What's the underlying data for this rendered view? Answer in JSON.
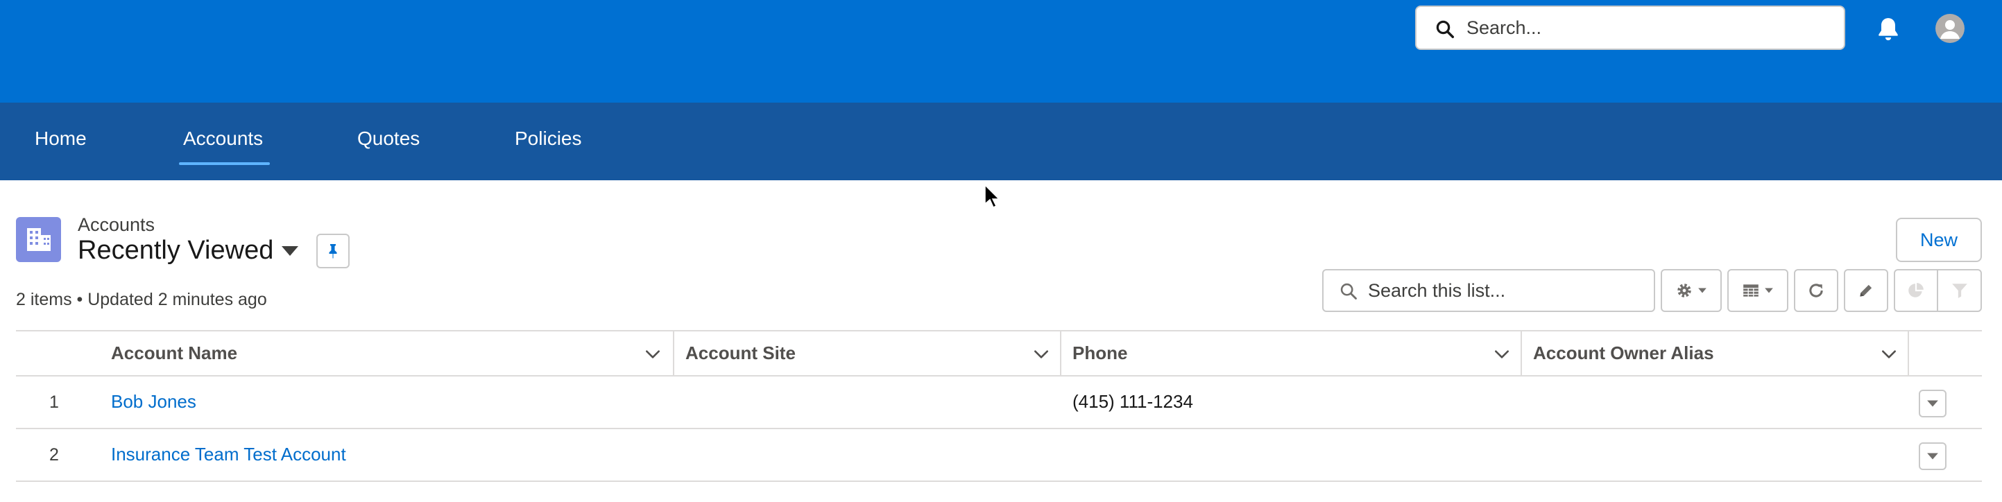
{
  "header": {
    "search_placeholder": "Search...",
    "search_icon": "search-icon",
    "notification_icon": "bell-icon",
    "avatar_icon": "user-avatar-icon"
  },
  "nav": {
    "items": [
      {
        "label": "Home"
      },
      {
        "label": "Accounts",
        "active": true
      },
      {
        "label": "Quotes"
      },
      {
        "label": "Policies"
      }
    ]
  },
  "list_view": {
    "object_label": "Accounts",
    "view_name": "Recently Viewed",
    "meta": "2 items • Updated 2 minutes ago",
    "new_label": "New",
    "search_placeholder": "Search this list...",
    "toolbar_icons": [
      "gear-icon",
      "table-icon",
      "refresh-icon",
      "pencil-icon",
      "pie-chart-icon",
      "filter-icon"
    ]
  },
  "table": {
    "columns": [
      "Account Name",
      "Account Site",
      "Phone",
      "Account Owner Alias"
    ],
    "rows": [
      {
        "num": "1",
        "account_name": "Bob Jones",
        "account_site": "",
        "phone": "(415) 111-1234",
        "owner_alias": ""
      },
      {
        "num": "2",
        "account_name": "Insurance Team Test Account",
        "account_site": "",
        "phone": "",
        "owner_alias": ""
      }
    ]
  },
  "colors": {
    "header_blue": "#0070d2",
    "nav_blue": "#16579e",
    "link_blue": "#006dcc",
    "icon_purple": "#7f8de1"
  }
}
